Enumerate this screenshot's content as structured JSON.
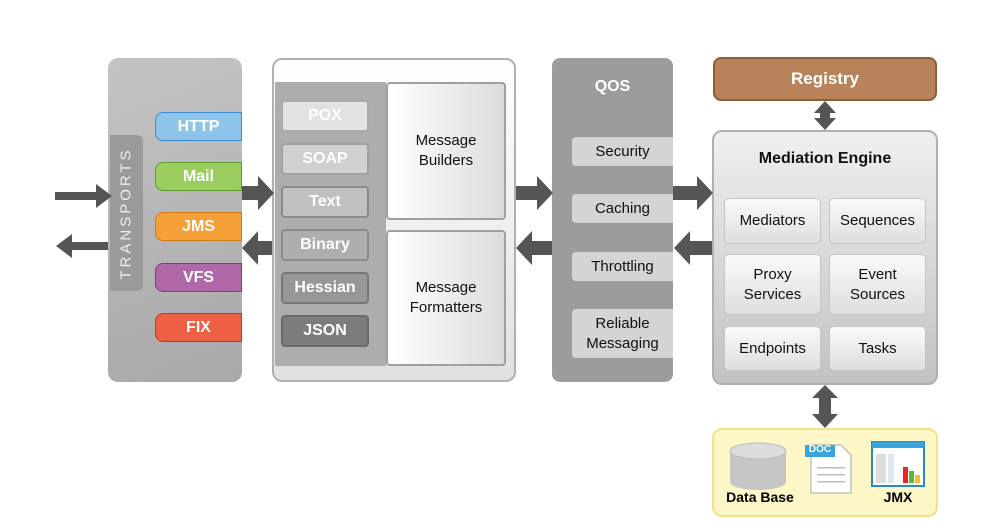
{
  "transports": {
    "label": "TRANSPORTS",
    "protocols": [
      {
        "label": "HTTP",
        "color": "#8ec3ea"
      },
      {
        "label": "Mail",
        "color": "#9ccd5f"
      },
      {
        "label": "JMS",
        "color": "#f6a03a"
      },
      {
        "label": "VFS",
        "color": "#b068a8"
      },
      {
        "label": "FIX",
        "color": "#ec6044"
      }
    ]
  },
  "formats": {
    "items": [
      "POX",
      "SOAP",
      "Text",
      "Binary",
      "Hessian",
      "JSON"
    ],
    "builders": "Message Builders",
    "formatters": "Message Formatters"
  },
  "qos": {
    "title": "QOS",
    "items": [
      "Security",
      "Caching",
      "Throttling",
      "Reliable Messaging"
    ]
  },
  "registry": {
    "label": "Registry",
    "color": "#b8835a"
  },
  "mediation": {
    "title": "Mediation Engine",
    "items": [
      "Mediators",
      "Sequences",
      "Proxy Services",
      "Event Sources",
      "Endpoints",
      "Tasks"
    ]
  },
  "resources": {
    "database": "Data Base",
    "doc": "DOC",
    "jmx": "JMX"
  }
}
